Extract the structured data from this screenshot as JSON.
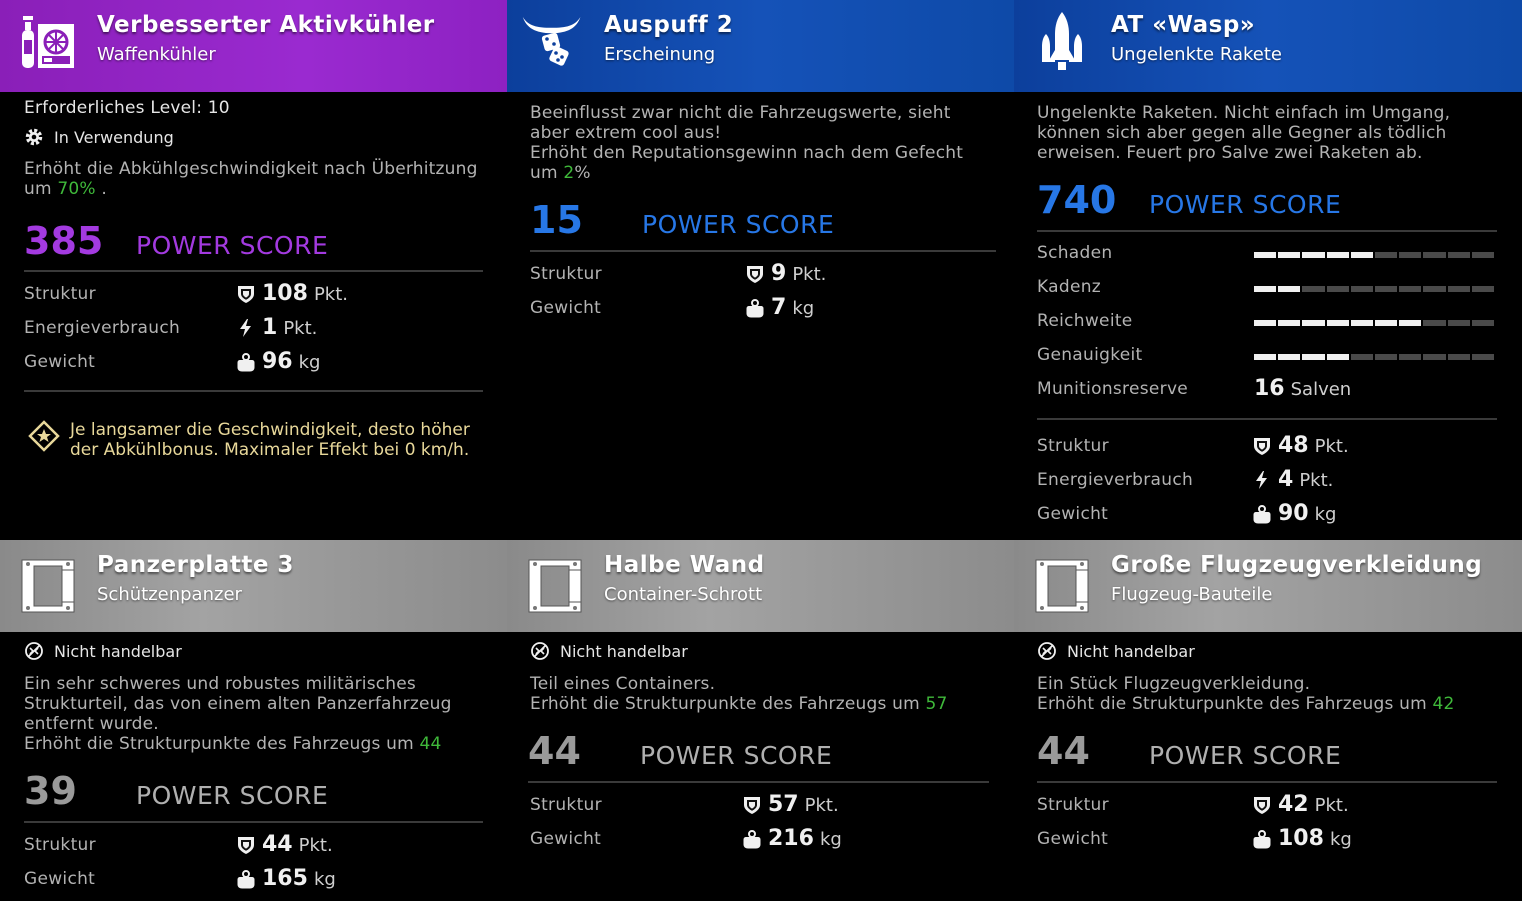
{
  "colors": {
    "purple": "#a33ae0",
    "blue": "#2777e6",
    "grey": "#9a9a9a",
    "green": "#3fb93a",
    "hint": "#e8d89a"
  },
  "cards": [
    {
      "title": "Verbesserter Aktivkühler",
      "subtitle": "Waffenkühler",
      "icon": "cooler-icon",
      "level": "Erforderliches Level: 10",
      "status": "In Verwendung",
      "desc1": "Erhöht die Abkühlgeschwindigkeit nach Überhitzung",
      "desc2_pre": "um ",
      "desc2_val": "70%",
      "desc2_post": " .",
      "power": "385",
      "power_label": "POWER SCORE",
      "stats": [
        {
          "label": "Struktur",
          "icon": "shield-icon",
          "value": "108",
          "unit": "Pkt."
        },
        {
          "label": "Energieverbrauch",
          "icon": "bolt-icon",
          "value": "1",
          "unit": "Pkt."
        },
        {
          "label": "Gewicht",
          "icon": "weight-icon",
          "value": "96",
          "unit": "kg"
        }
      ],
      "hint": "Je langsamer die Geschwindigkeit, desto höher der Abkühlbonus. Maximaler Effekt bei 0 km/h."
    },
    {
      "title": "Auspuff 2",
      "subtitle": "Erscheinung",
      "icon": "horns-dice-icon",
      "desc1": "Beeinflusst zwar nicht die Fahrzeugswerte, sieht",
      "desc2": "aber extrem cool aus!",
      "desc3": "Erhöht den Reputationsgewinn nach dem Gefecht",
      "desc4_pre": "um ",
      "desc4_val": "2",
      "desc4_post": "%",
      "power": "15",
      "power_label": "POWER SCORE",
      "stats": [
        {
          "label": "Struktur",
          "icon": "shield-icon",
          "value": "9",
          "unit": "Pkt."
        },
        {
          "label": "Gewicht",
          "icon": "weight-icon",
          "value": "7",
          "unit": "kg"
        }
      ]
    },
    {
      "title": "AT «Wasp»",
      "subtitle": "Ungelenkte Rakete",
      "icon": "rocket-icon",
      "desc1": "Ungelenkte Raketen. Nicht einfach im Umgang,",
      "desc2": "können sich aber gegen alle Gegner als tödlich",
      "desc3": "erweisen. Feuert pro Salve zwei Raketen ab.",
      "power": "740",
      "power_label": "POWER SCORE",
      "bars": [
        {
          "label": "Schaden",
          "level": 5
        },
        {
          "label": "Kadenz",
          "level": 2
        },
        {
          "label": "Reichweite",
          "level": 7
        },
        {
          "label": "Genauigkeit",
          "level": 4
        }
      ],
      "bar_segments": 10,
      "ammo": {
        "label": "Munitionsreserve",
        "value": "16",
        "unit": "Salven"
      },
      "stats": [
        {
          "label": "Struktur",
          "icon": "shield-icon",
          "value": "48",
          "unit": "Pkt."
        },
        {
          "label": "Energieverbrauch",
          "icon": "bolt-icon",
          "value": "4",
          "unit": "Pkt."
        },
        {
          "label": "Gewicht",
          "icon": "weight-icon",
          "value": "90",
          "unit": "kg"
        }
      ]
    },
    {
      "title": "Panzerplatte 3",
      "subtitle": "Schützenpanzer",
      "icon": "frame-part-icon",
      "status": "Nicht handelbar",
      "desc1": "Ein sehr schweres und robustes militärisches",
      "desc2": "Strukturteil, das von einem alten Panzerfahrzeug",
      "desc3": "entfernt wurde.",
      "desc4_pre": "Erhöht die Strukturpunkte des Fahrzeugs um ",
      "desc4_val": "44",
      "power": "39",
      "power_label": "POWER SCORE",
      "stats": [
        {
          "label": "Struktur",
          "icon": "shield-icon",
          "value": "44",
          "unit": "Pkt."
        },
        {
          "label": "Gewicht",
          "icon": "weight-icon",
          "value": "165",
          "unit": "kg"
        }
      ]
    },
    {
      "title": "Halbe Wand",
      "subtitle": "Container-Schrott",
      "icon": "frame-part-icon",
      "status": "Nicht handelbar",
      "desc1": "Teil eines Containers.",
      "desc2_pre": "Erhöht die Strukturpunkte des Fahrzeugs um ",
      "desc2_val": "57",
      "power": "44",
      "power_label": "POWER SCORE",
      "stats": [
        {
          "label": "Struktur",
          "icon": "shield-icon",
          "value": "57",
          "unit": "Pkt."
        },
        {
          "label": "Gewicht",
          "icon": "weight-icon",
          "value": "216",
          "unit": "kg"
        }
      ]
    },
    {
      "title": "Große Flugzeugverkleidung",
      "subtitle": "Flugzeug-Bauteile",
      "icon": "frame-part-icon",
      "status": "Nicht handelbar",
      "desc1": "Ein Stück Flugzeugverkleidung.",
      "desc2_pre": "Erhöht die Strukturpunkte des Fahrzeugs um ",
      "desc2_val": "42",
      "power": "44",
      "power_label": "POWER SCORE",
      "stats": [
        {
          "label": "Struktur",
          "icon": "shield-icon",
          "value": "42",
          "unit": "Pkt."
        },
        {
          "label": "Gewicht",
          "icon": "weight-icon",
          "value": "108",
          "unit": "kg"
        }
      ]
    }
  ]
}
